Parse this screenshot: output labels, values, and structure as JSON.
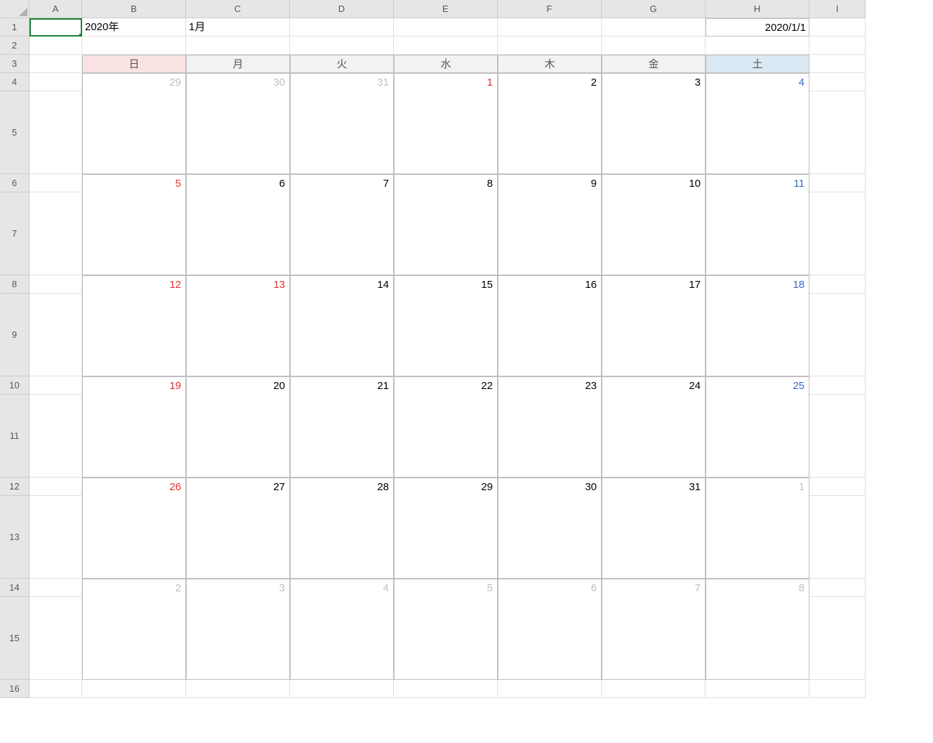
{
  "columns": [
    "A",
    "B",
    "C",
    "D",
    "E",
    "F",
    "G",
    "H",
    "I"
  ],
  "rows": [
    "1",
    "2",
    "3",
    "4",
    "5",
    "6",
    "7",
    "8",
    "9",
    "10",
    "11",
    "12",
    "13",
    "14",
    "15",
    "16"
  ],
  "row1": {
    "B": "2020年",
    "C": "1月",
    "H": "2020/1/1"
  },
  "weekdays": [
    "日",
    "月",
    "火",
    "水",
    "木",
    "金",
    "土"
  ],
  "calendar": [
    [
      {
        "v": "29",
        "c": "muted"
      },
      {
        "v": "30",
        "c": "muted"
      },
      {
        "v": "31",
        "c": "muted"
      },
      {
        "v": "1",
        "c": "red"
      },
      {
        "v": "2",
        "c": ""
      },
      {
        "v": "3",
        "c": ""
      },
      {
        "v": "4",
        "c": "blue"
      }
    ],
    [
      {
        "v": "5",
        "c": "red"
      },
      {
        "v": "6",
        "c": ""
      },
      {
        "v": "7",
        "c": ""
      },
      {
        "v": "8",
        "c": ""
      },
      {
        "v": "9",
        "c": ""
      },
      {
        "v": "10",
        "c": ""
      },
      {
        "v": "11",
        "c": "blue"
      }
    ],
    [
      {
        "v": "12",
        "c": "red"
      },
      {
        "v": "13",
        "c": "red"
      },
      {
        "v": "14",
        "c": ""
      },
      {
        "v": "15",
        "c": ""
      },
      {
        "v": "16",
        "c": ""
      },
      {
        "v": "17",
        "c": ""
      },
      {
        "v": "18",
        "c": "blue"
      }
    ],
    [
      {
        "v": "19",
        "c": "red"
      },
      {
        "v": "20",
        "c": ""
      },
      {
        "v": "21",
        "c": ""
      },
      {
        "v": "22",
        "c": ""
      },
      {
        "v": "23",
        "c": ""
      },
      {
        "v": "24",
        "c": ""
      },
      {
        "v": "25",
        "c": "blue"
      }
    ],
    [
      {
        "v": "26",
        "c": "red"
      },
      {
        "v": "27",
        "c": ""
      },
      {
        "v": "28",
        "c": ""
      },
      {
        "v": "29",
        "c": ""
      },
      {
        "v": "30",
        "c": ""
      },
      {
        "v": "31",
        "c": ""
      },
      {
        "v": "1",
        "c": "muted"
      }
    ],
    [
      {
        "v": "2",
        "c": "muted"
      },
      {
        "v": "3",
        "c": "muted"
      },
      {
        "v": "4",
        "c": "muted"
      },
      {
        "v": "5",
        "c": "muted"
      },
      {
        "v": "6",
        "c": "muted"
      },
      {
        "v": "7",
        "c": "muted"
      },
      {
        "v": "8",
        "c": "muted"
      }
    ]
  ]
}
